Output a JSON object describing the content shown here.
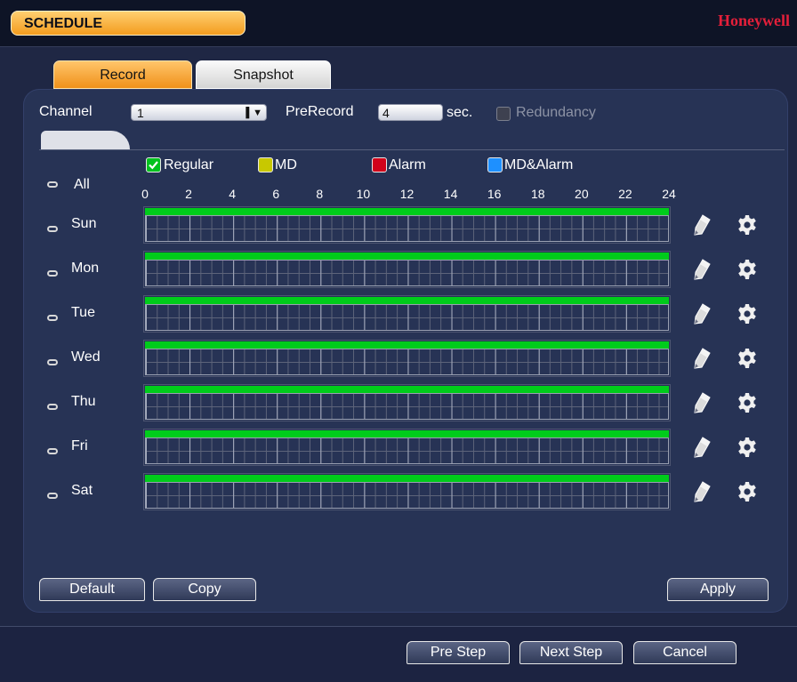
{
  "header": {
    "title": "SCHEDULE",
    "brand": "Honeywell"
  },
  "tabs": [
    {
      "label": "Record",
      "active": true
    },
    {
      "label": "Snapshot",
      "active": false
    }
  ],
  "controls": {
    "channel_label": "Channel",
    "channel_value": "1",
    "prerecord_label": "PreRecord",
    "prerecord_value": "4",
    "prerecord_unit": "sec.",
    "redundancy_label": "Redundancy"
  },
  "legend": [
    {
      "label": "Regular",
      "color": "#00c21f",
      "checked": true
    },
    {
      "label": "MD",
      "color": "#c8c800",
      "checked": false
    },
    {
      "label": "Alarm",
      "color": "#d0021b",
      "checked": false
    },
    {
      "label": "MD&Alarm",
      "color": "#1e90ff",
      "checked": false
    }
  ],
  "all_label": "All",
  "hours": [
    "0",
    "2",
    "4",
    "6",
    "8",
    "10",
    "12",
    "14",
    "16",
    "18",
    "20",
    "22",
    "24"
  ],
  "days": [
    {
      "label": "Sun",
      "regular": [
        0,
        24
      ]
    },
    {
      "label": "Mon",
      "regular": [
        0,
        24
      ]
    },
    {
      "label": "Tue",
      "regular": [
        0,
        24
      ]
    },
    {
      "label": "Wed",
      "regular": [
        0,
        24
      ]
    },
    {
      "label": "Thu",
      "regular": [
        0,
        24
      ]
    },
    {
      "label": "Fri",
      "regular": [
        0,
        24
      ]
    },
    {
      "label": "Sat",
      "regular": [
        0,
        24
      ]
    }
  ],
  "buttons": {
    "default": "Default",
    "copy": "Copy",
    "apply": "Apply",
    "pre_step": "Pre Step",
    "next_step": "Next Step",
    "cancel": "Cancel"
  },
  "colors": {
    "accent": "#f39c1e",
    "background": "#1f2744",
    "regular_bar": "#00cc1b"
  },
  "icons": {
    "edit": "pencil-icon",
    "settings": "gear-icon"
  }
}
